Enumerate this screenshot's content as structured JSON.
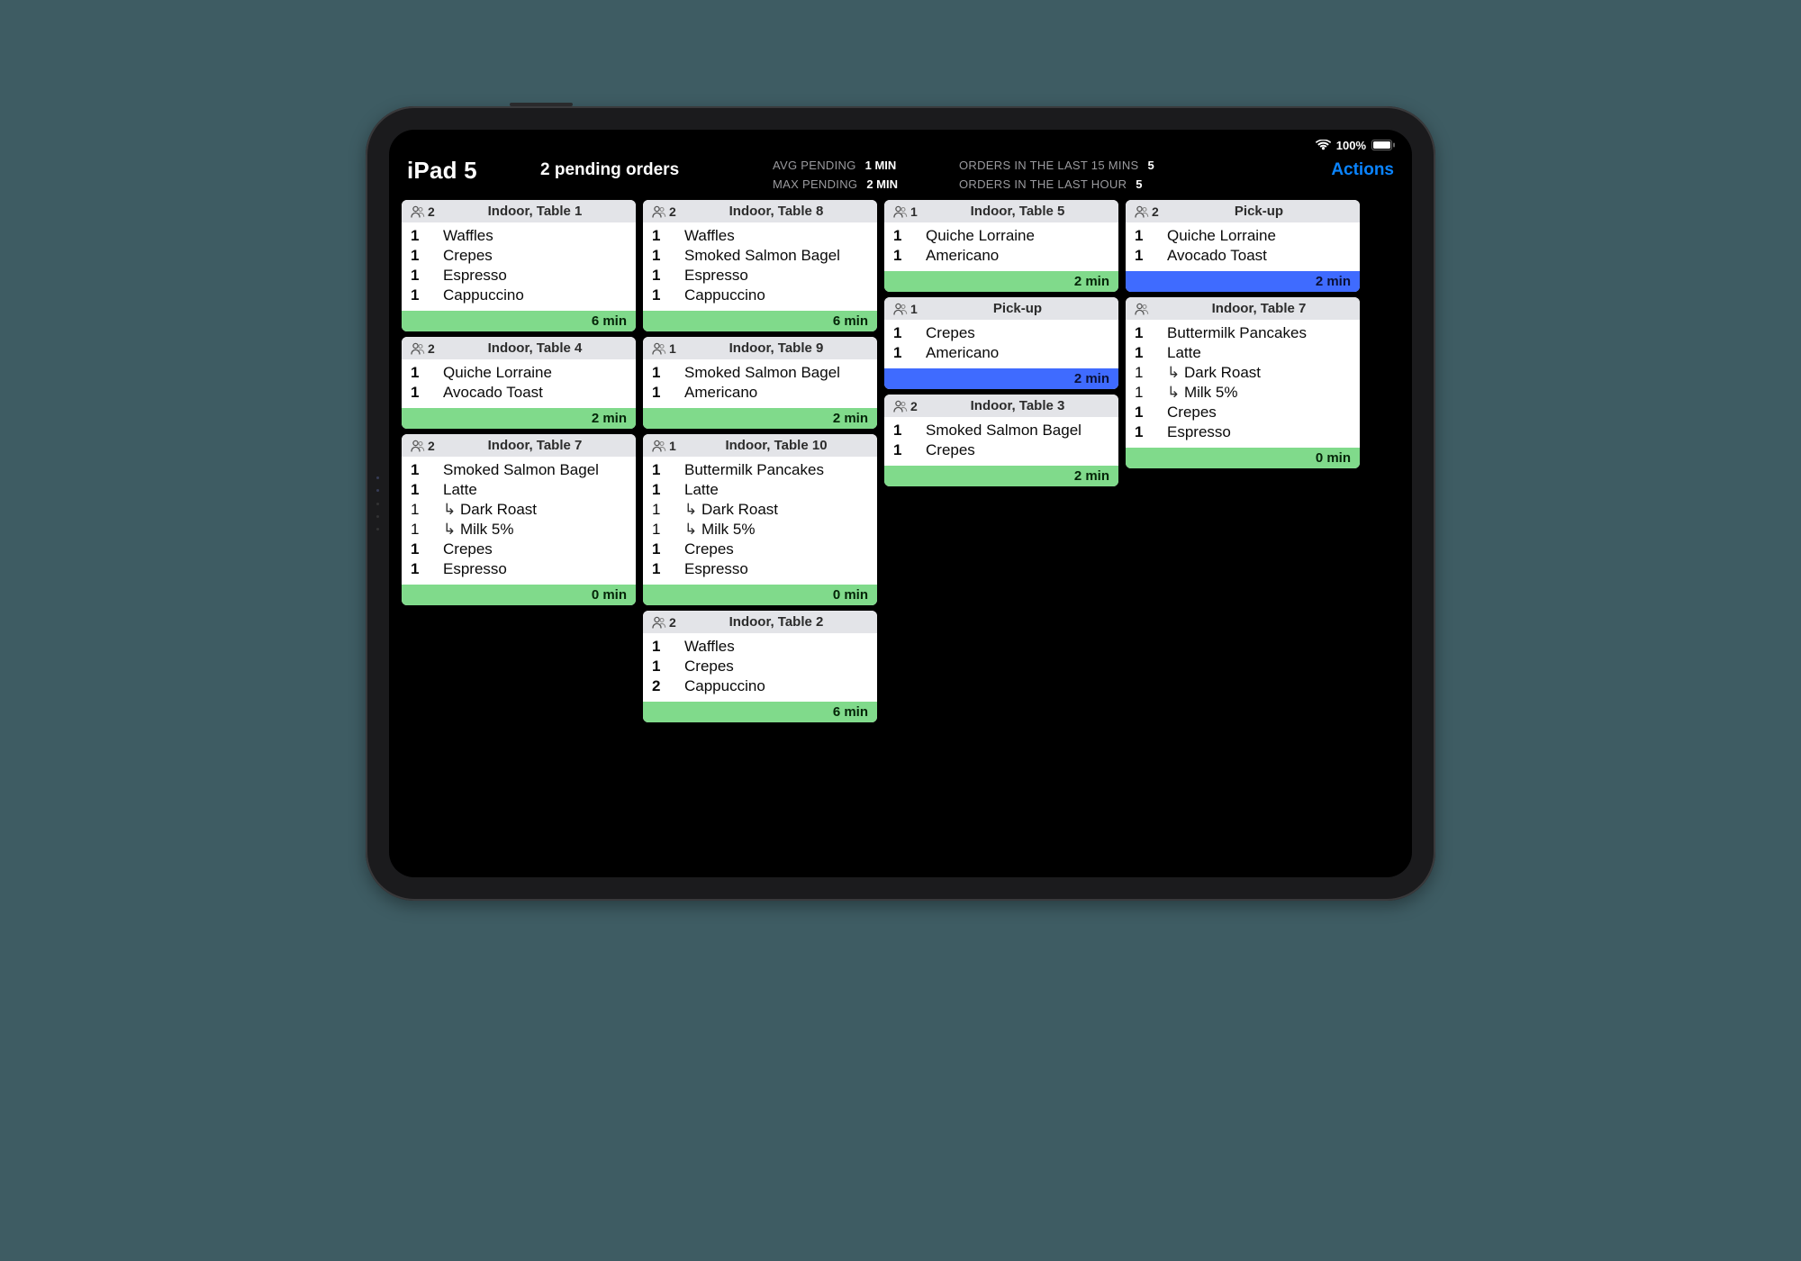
{
  "statusbar": {
    "battery_pct": "100%"
  },
  "header": {
    "device": "iPad 5",
    "pending": "2 pending orders",
    "stats": {
      "avg_label": "AVG PENDING",
      "avg_val": "1 MIN",
      "max_label": "MAX PENDING",
      "max_val": "2 MIN",
      "last15_label": "ORDERS IN THE LAST 15 MINS",
      "last15_val": "5",
      "last60_label": "ORDERS IN THE LAST HOUR",
      "last60_val": "5"
    },
    "actions": "Actions"
  },
  "columns": [
    [
      {
        "guests": "2",
        "title": "Indoor, Table 1",
        "footer_style": "green",
        "time": "6 min",
        "items": [
          {
            "qty": "1",
            "name": "Waffles"
          },
          {
            "qty": "1",
            "name": "Crepes"
          },
          {
            "qty": "1",
            "name": "Espresso"
          },
          {
            "qty": "1",
            "name": "Cappuccino"
          }
        ]
      },
      {
        "guests": "2",
        "title": "Indoor, Table 4",
        "footer_style": "green",
        "time": "2 min",
        "items": [
          {
            "qty": "1",
            "name": "Quiche Lorraine"
          },
          {
            "qty": "1",
            "name": "Avocado Toast"
          }
        ]
      },
      {
        "guests": "2",
        "title": "Indoor, Table 7",
        "footer_style": "green",
        "time": "0 min",
        "items": [
          {
            "qty": "1",
            "name": "Smoked Salmon Bagel"
          },
          {
            "qty": "1",
            "name": "Latte"
          },
          {
            "qty": "1",
            "name": "Dark Roast",
            "mod": true
          },
          {
            "qty": "1",
            "name": "Milk 5%",
            "mod": true
          },
          {
            "qty": "1",
            "name": "Crepes"
          },
          {
            "qty": "1",
            "name": "Espresso"
          }
        ]
      }
    ],
    [
      {
        "guests": "2",
        "title": "Indoor, Table 8",
        "footer_style": "green",
        "time": "6 min",
        "items": [
          {
            "qty": "1",
            "name": "Waffles"
          },
          {
            "qty": "1",
            "name": "Smoked Salmon Bagel"
          },
          {
            "qty": "1",
            "name": "Espresso"
          },
          {
            "qty": "1",
            "name": "Cappuccino"
          }
        ]
      },
      {
        "guests": "1",
        "title": "Indoor, Table 9",
        "footer_style": "green",
        "time": "2 min",
        "items": [
          {
            "qty": "1",
            "name": "Smoked Salmon Bagel"
          },
          {
            "qty": "1",
            "name": "Americano"
          }
        ]
      },
      {
        "guests": "1",
        "title": "Indoor, Table 10",
        "footer_style": "green",
        "time": "0 min",
        "items": [
          {
            "qty": "1",
            "name": "Buttermilk Pancakes"
          },
          {
            "qty": "1",
            "name": "Latte"
          },
          {
            "qty": "1",
            "name": "Dark Roast",
            "mod": true
          },
          {
            "qty": "1",
            "name": "Milk 5%",
            "mod": true
          },
          {
            "qty": "1",
            "name": "Crepes"
          },
          {
            "qty": "1",
            "name": "Espresso"
          }
        ]
      },
      {
        "guests": "2",
        "title": "Indoor, Table 2",
        "footer_style": "green",
        "time": "6 min",
        "items": [
          {
            "qty": "1",
            "name": "Waffles"
          },
          {
            "qty": "1",
            "name": "Crepes"
          },
          {
            "qty": "2",
            "name": "Cappuccino"
          }
        ]
      }
    ],
    [
      {
        "guests": "1",
        "title": "Indoor, Table 5",
        "footer_style": "green",
        "time": "2 min",
        "items": [
          {
            "qty": "1",
            "name": "Quiche Lorraine"
          },
          {
            "qty": "1",
            "name": "Americano"
          }
        ]
      },
      {
        "guests": "1",
        "title": "Pick-up",
        "footer_style": "blue",
        "time": "2 min",
        "items": [
          {
            "qty": "1",
            "name": "Crepes"
          },
          {
            "qty": "1",
            "name": "Americano"
          }
        ]
      },
      {
        "guests": "2",
        "title": "Indoor, Table 3",
        "footer_style": "green",
        "time": "2 min",
        "items": [
          {
            "qty": "1",
            "name": "Smoked Salmon Bagel"
          },
          {
            "qty": "1",
            "name": "Crepes"
          }
        ]
      }
    ],
    [
      {
        "guests": "2",
        "title": "Pick-up",
        "footer_style": "blue",
        "time": "2 min",
        "items": [
          {
            "qty": "1",
            "name": "Quiche Lorraine"
          },
          {
            "qty": "1",
            "name": "Avocado Toast"
          }
        ]
      },
      {
        "guests": "",
        "title": "Indoor, Table 7",
        "footer_style": "green",
        "time": "0 min",
        "items": [
          {
            "qty": "1",
            "name": "Buttermilk Pancakes"
          },
          {
            "qty": "1",
            "name": "Latte"
          },
          {
            "qty": "1",
            "name": "Dark Roast",
            "mod": true
          },
          {
            "qty": "1",
            "name": "Milk 5%",
            "mod": true
          },
          {
            "qty": "1",
            "name": "Crepes"
          },
          {
            "qty": "1",
            "name": "Espresso"
          }
        ]
      }
    ]
  ]
}
